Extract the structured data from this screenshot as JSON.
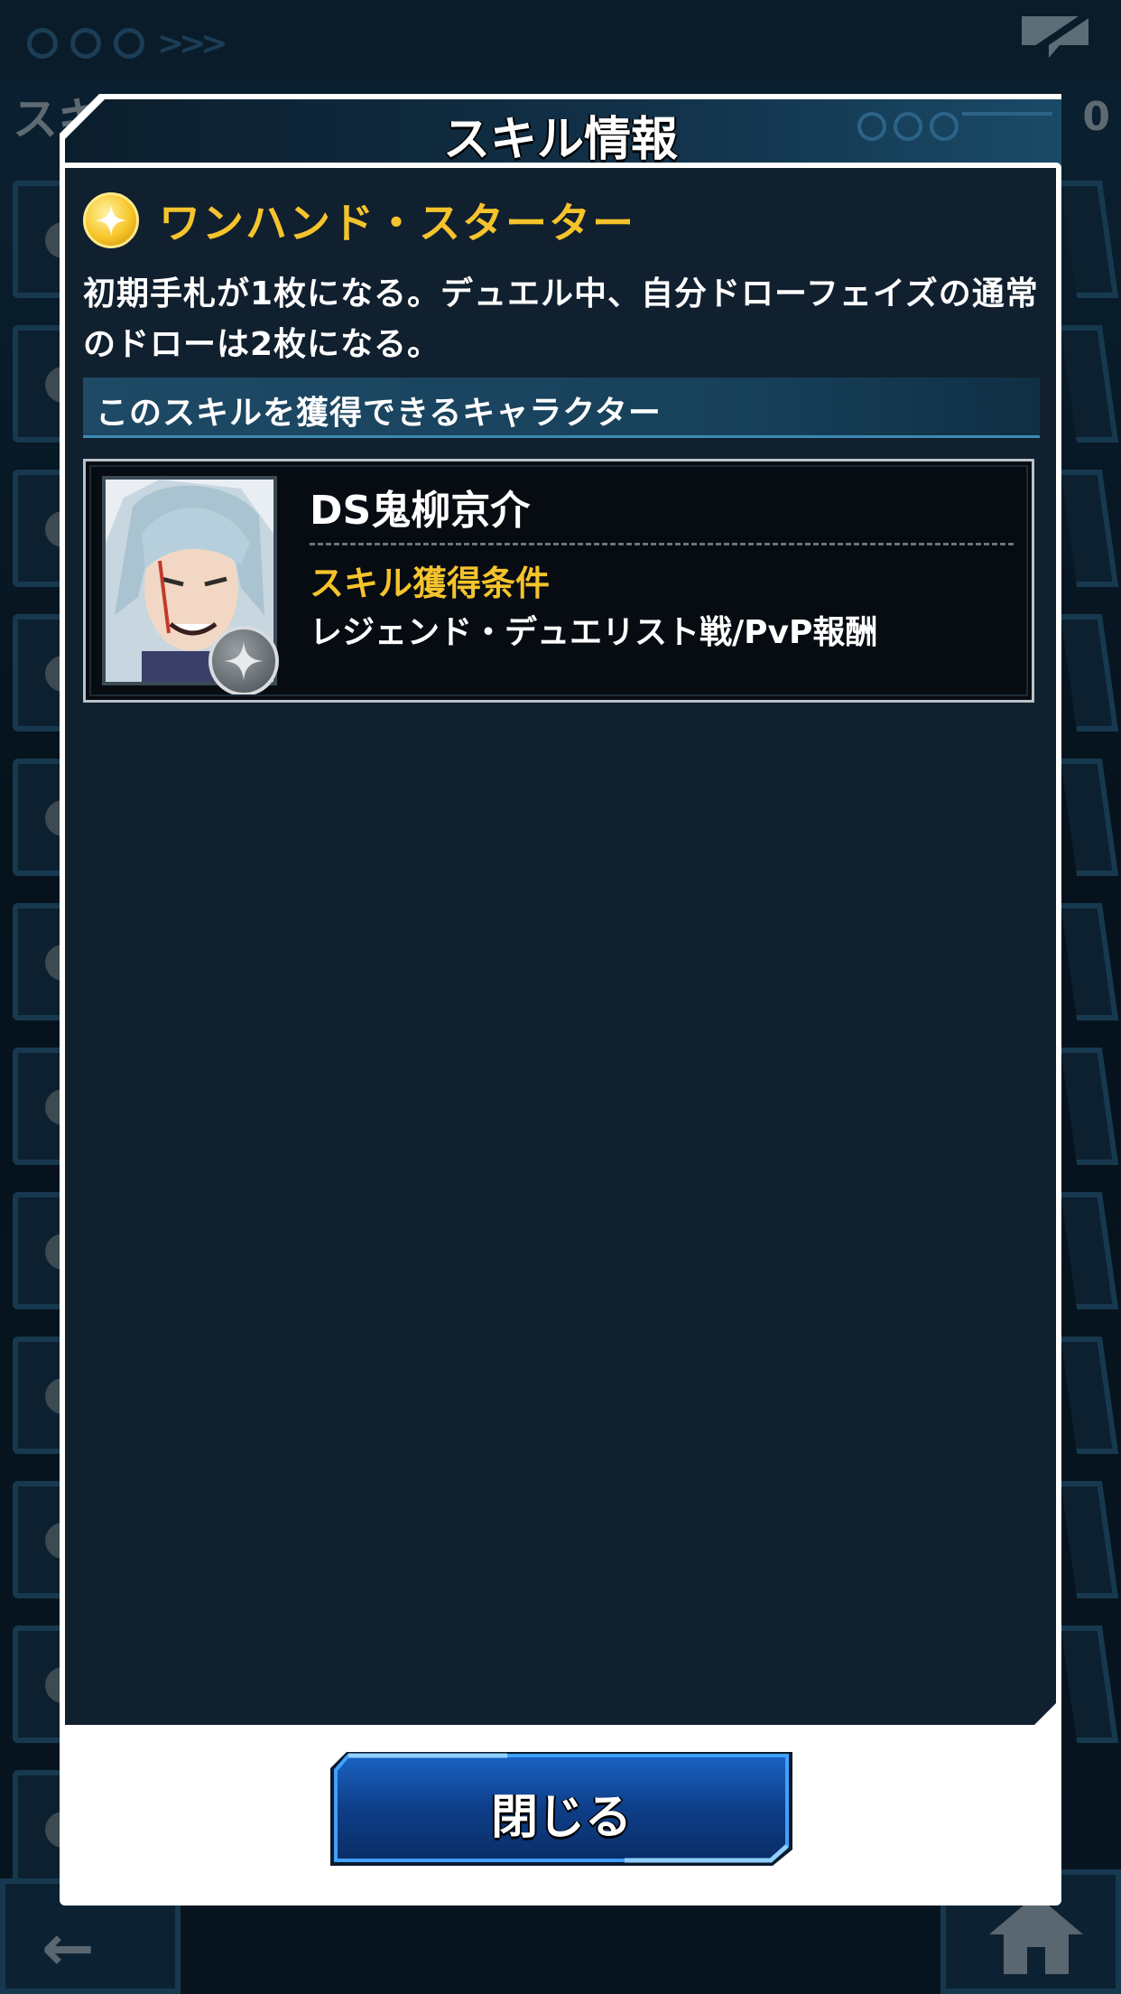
{
  "background": {
    "screen_title": "スキ",
    "count_fragment": "0"
  },
  "modal": {
    "title": "スキル情報",
    "skill": {
      "icon": "star-icon",
      "name": "ワンハンド・スターター",
      "description": "初期手札が1枚になる。デュエル中、自分ドローフェイズの通常のドローは2枚になる。"
    },
    "section_label": "このスキルを獲得できるキャラクター",
    "character": {
      "name": "DS鬼柳京介",
      "condition_label": "スキル獲得条件",
      "condition_value": "レジェンド・デュエリスト戦/PvP報酬",
      "rarity_icon": "silver-star-icon"
    },
    "close_label": "閉じる"
  },
  "colors": {
    "accent_gold": "#f5c32c",
    "panel_dark": "#11202e",
    "button_blue": "#0e3f8a"
  }
}
